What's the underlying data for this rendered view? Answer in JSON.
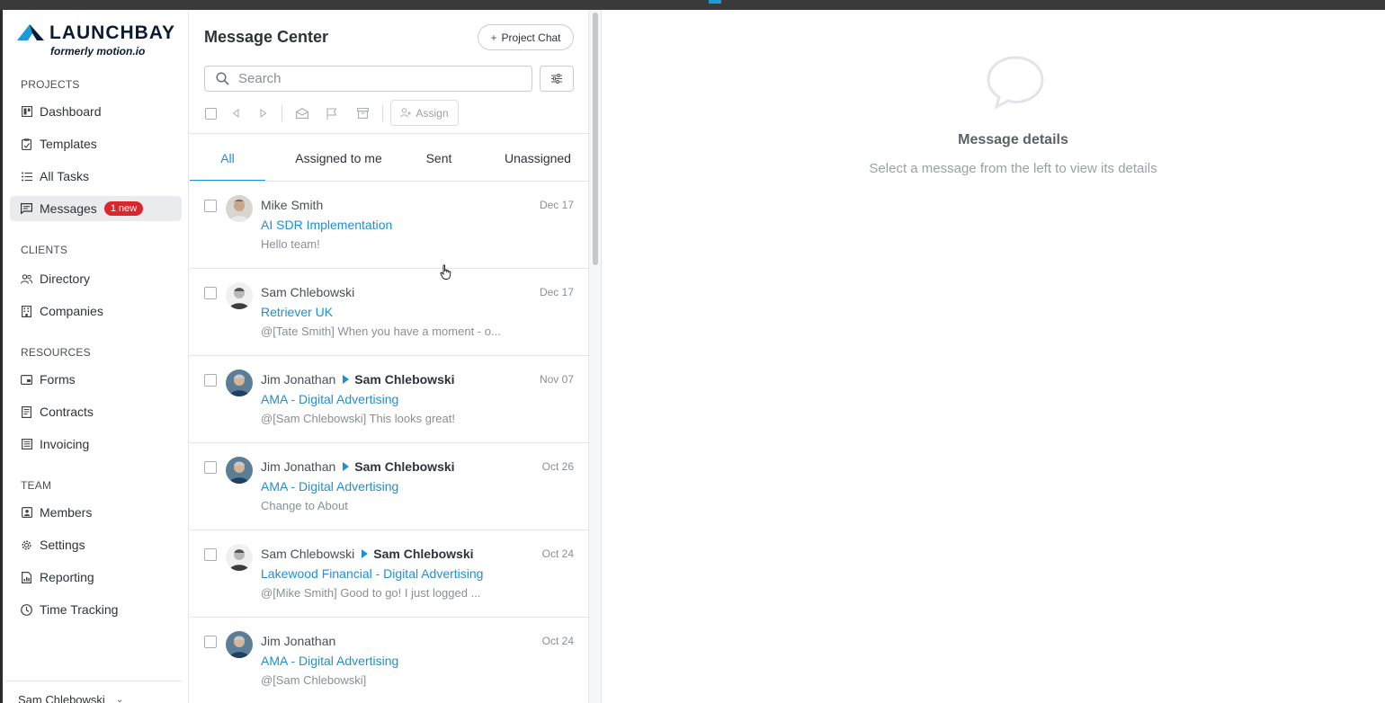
{
  "brand": {
    "name": "LAUNCHBAY",
    "subtitle": "formerly motion.io",
    "accent_color": "#1f8fd6",
    "logo_icon": "launchbay-logo-icon"
  },
  "sidebar": {
    "sections": [
      {
        "title": "PROJECTS",
        "items": [
          {
            "label": "Dashboard",
            "icon": "dashboard-icon"
          },
          {
            "label": "Templates",
            "icon": "template-icon"
          },
          {
            "label": "All Tasks",
            "icon": "list-icon"
          },
          {
            "label": "Messages",
            "icon": "message-icon",
            "badge": "1 new",
            "active": true
          }
        ]
      },
      {
        "title": "CLIENTS",
        "items": [
          {
            "label": "Directory",
            "icon": "people-icon"
          },
          {
            "label": "Companies",
            "icon": "building-icon"
          }
        ]
      },
      {
        "title": "RESOURCES",
        "items": [
          {
            "label": "Forms",
            "icon": "form-icon"
          },
          {
            "label": "Contracts",
            "icon": "document-icon"
          },
          {
            "label": "Invoicing",
            "icon": "invoice-icon"
          }
        ]
      },
      {
        "title": "TEAM",
        "items": [
          {
            "label": "Members",
            "icon": "member-icon"
          },
          {
            "label": "Settings",
            "icon": "gear-icon"
          },
          {
            "label": "Reporting",
            "icon": "report-icon"
          },
          {
            "label": "Time Tracking",
            "icon": "clock-icon"
          }
        ]
      }
    ],
    "user_name": "Sam Chlebowski"
  },
  "message_center": {
    "title": "Message Center",
    "project_chat_label": "Project Chat",
    "search_placeholder": "Search",
    "assign_label": "Assign",
    "tabs": [
      {
        "label": "All",
        "active": true
      },
      {
        "label": "Assigned to me"
      },
      {
        "label": "Sent"
      },
      {
        "label": "Unassigned"
      }
    ],
    "messages": [
      {
        "from": "Mike Smith",
        "to": "",
        "date": "Dec 17",
        "subject": "AI SDR Implementation",
        "preview": "Hello team!"
      },
      {
        "from": "Sam Chlebowski",
        "to": "",
        "date": "Dec 17",
        "subject": "Retriever UK",
        "preview": "@[Tate Smith] When you have a moment - o..."
      },
      {
        "from": "Jim Jonathan",
        "to": "Sam Chlebowski",
        "date": "Nov 07",
        "subject": "AMA - Digital Advertising",
        "preview": "@[Sam Chlebowski] This looks great!"
      },
      {
        "from": "Jim Jonathan",
        "to": "Sam Chlebowski",
        "date": "Oct 26",
        "subject": "AMA - Digital Advertising",
        "preview": "Change to About"
      },
      {
        "from": "Sam Chlebowski",
        "to": "Sam Chlebowski",
        "date": "Oct 24",
        "subject": "Lakewood Financial - Digital Advertising",
        "preview": "@[Mike Smith] Good to go! I just logged ..."
      },
      {
        "from": "Jim Jonathan",
        "to": "",
        "date": "Oct 24",
        "subject": "AMA - Digital Advertising",
        "preview": "@[Sam Chlebowski]"
      }
    ]
  },
  "details": {
    "title": "Message details",
    "subtitle": "Select a message from the left to view its details"
  }
}
